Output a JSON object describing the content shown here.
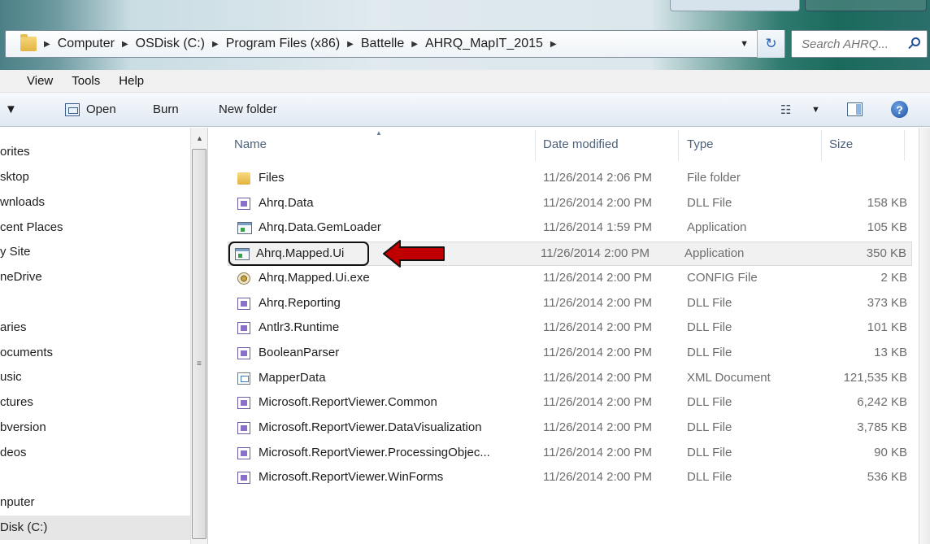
{
  "address": {
    "crumbs": [
      "Computer",
      "OSDisk (C:)",
      "Program Files (x86)",
      "Battelle",
      "AHRQ_MapIT_2015"
    ]
  },
  "search": {
    "placeholder": "Search AHRQ..."
  },
  "menu": {
    "items": [
      "View",
      "Tools",
      "Help"
    ]
  },
  "toolbar": {
    "organize_label": "▼",
    "open_label": "Open",
    "burn_label": "Burn",
    "new_folder_label": "New folder"
  },
  "nav": {
    "items": [
      "orites",
      "sktop",
      "wnloads",
      "cent Places",
      "y Site",
      "neDrive",
      "aries",
      "ocuments",
      "usic",
      "ctures",
      "bversion",
      "deos",
      "nputer",
      "Disk (C:)"
    ]
  },
  "columns": {
    "name": "Name",
    "date": "Date modified",
    "type": "Type",
    "size": "Size"
  },
  "files": [
    {
      "name": "Files",
      "date": "11/26/2014 2:06 PM",
      "type": "File folder",
      "size": "",
      "icon": "folder-icon"
    },
    {
      "name": "Ahrq.Data",
      "date": "11/26/2014 2:00 PM",
      "type": "DLL File",
      "size": "158 KB",
      "icon": "dll-icon"
    },
    {
      "name": "Ahrq.Data.GemLoader",
      "date": "11/26/2014 1:59 PM",
      "type": "Application",
      "size": "105 KB",
      "icon": "application-icon"
    },
    {
      "name": "Ahrq.Mapped.Ui",
      "date": "11/26/2014 2:00 PM",
      "type": "Application",
      "size": "350 KB",
      "icon": "application-icon"
    },
    {
      "name": "Ahrq.Mapped.Ui.exe",
      "date": "11/26/2014 2:00 PM",
      "type": "CONFIG File",
      "size": "2 KB",
      "icon": "config-icon"
    },
    {
      "name": "Ahrq.Reporting",
      "date": "11/26/2014 2:00 PM",
      "type": "DLL File",
      "size": "373 KB",
      "icon": "dll-icon"
    },
    {
      "name": "Antlr3.Runtime",
      "date": "11/26/2014 2:00 PM",
      "type": "DLL File",
      "size": "101 KB",
      "icon": "dll-icon"
    },
    {
      "name": "BooleanParser",
      "date": "11/26/2014 2:00 PM",
      "type": "DLL File",
      "size": "13 KB",
      "icon": "dll-icon"
    },
    {
      "name": "MapperData",
      "date": "11/26/2014 2:00 PM",
      "type": "XML Document",
      "size": "121,535 KB",
      "icon": "xml-icon"
    },
    {
      "name": "Microsoft.ReportViewer.Common",
      "date": "11/26/2014 2:00 PM",
      "type": "DLL File",
      "size": "6,242 KB",
      "icon": "dll-icon"
    },
    {
      "name": "Microsoft.ReportViewer.DataVisualization",
      "date": "11/26/2014 2:00 PM",
      "type": "DLL File",
      "size": "3,785 KB",
      "icon": "dll-icon"
    },
    {
      "name": "Microsoft.ReportViewer.ProcessingObjec...",
      "date": "11/26/2014 2:00 PM",
      "type": "DLL File",
      "size": "90 KB",
      "icon": "dll-icon"
    },
    {
      "name": "Microsoft.ReportViewer.WinForms",
      "date": "11/26/2014 2:00 PM",
      "type": "DLL File",
      "size": "536 KB",
      "icon": "dll-icon"
    }
  ],
  "selected_file_index": 3,
  "colors": {
    "arrow": "#c00000",
    "header_text": "#4c607a",
    "secondary_text": "#6d6d6d"
  }
}
